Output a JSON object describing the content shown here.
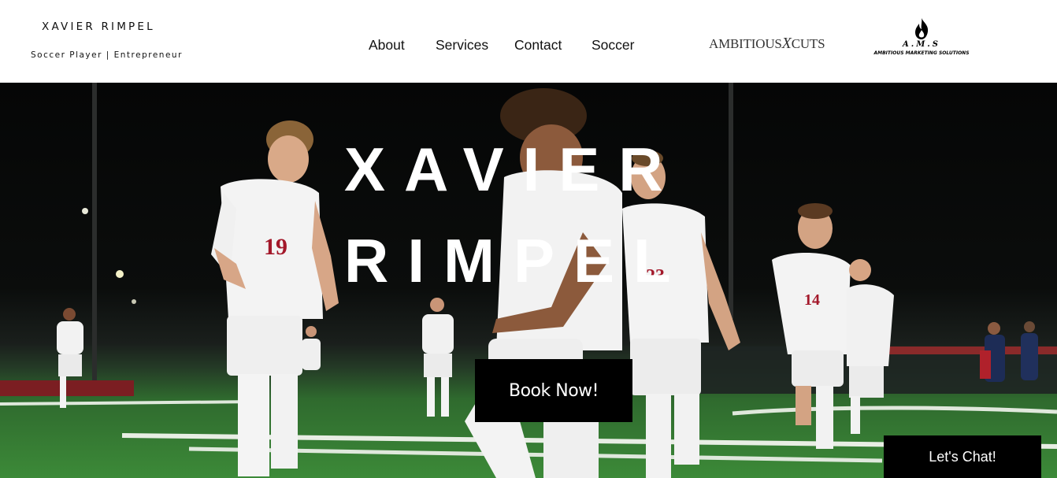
{
  "header": {
    "brand_name": "XAVIER RIMPEL",
    "brand_tagline": "Soccer Player | Entrepreneur",
    "nav": [
      {
        "label": "About"
      },
      {
        "label": "Services"
      },
      {
        "label": "Contact"
      },
      {
        "label": "Soccer"
      }
    ],
    "logos": {
      "cuts": "AMBITIOUS CUTS",
      "ams_letters": "A.M.S",
      "ams_full": "AMBITIOUS MARKETING SOLUTIONS"
    }
  },
  "hero": {
    "title_line1": "XAVIER",
    "title_line2": "RIMPEL",
    "book_button": "Book Now!",
    "jersey_numbers": [
      "19",
      "23",
      "14"
    ]
  },
  "chat": {
    "label": "Let's Chat!"
  },
  "colors": {
    "jersey_accent": "#a3182a",
    "field_green": "#3c8a38",
    "button_bg": "#000000"
  }
}
